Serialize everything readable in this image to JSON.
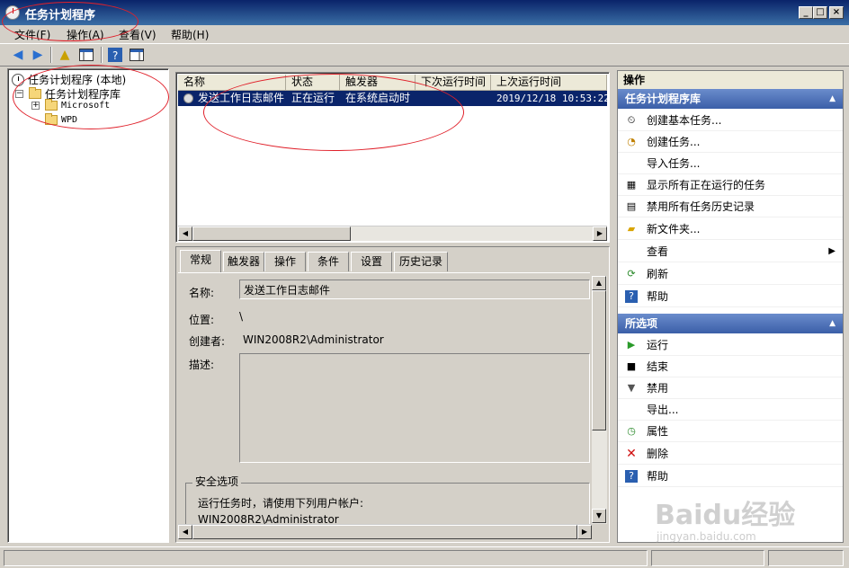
{
  "window": {
    "title": "任务计划程序",
    "controls": {
      "minimize": "_",
      "maximize": "□",
      "close": "×"
    }
  },
  "menu": [
    "文件(F)",
    "操作(A)",
    "查看(V)",
    "帮助(H)"
  ],
  "tree": {
    "root": "任务计划程序 (本地)",
    "library": "任务计划程序库",
    "children": [
      "Microsoft",
      "WPD"
    ],
    "expander_collapsed": "+",
    "expander_expanded": "−"
  },
  "tasklist": {
    "columns": [
      "名称",
      "状态",
      "触发器",
      "下次运行时间",
      "上次运行时间"
    ],
    "rows": [
      {
        "name": "发送工作日志邮件",
        "status": "正在运行",
        "trigger": "在系统启动时",
        "next_run": "",
        "last_run": "2019/12/18 10:53:22"
      }
    ]
  },
  "detail": {
    "tabs": [
      "常规",
      "触发器",
      "操作",
      "条件",
      "设置",
      "历史记录"
    ],
    "active_tab": "常规",
    "fields": {
      "name_label": "名称:",
      "name_value": "发送工作日志邮件",
      "location_label": "位置:",
      "location_value": "\\",
      "author_label": "创建者:",
      "author_value": "WIN2008R2\\Administrator",
      "desc_label": "描述:"
    },
    "security": {
      "title": "安全选项",
      "prompt": "运行任务时，请使用下列用户帐户:",
      "account": "WIN2008R2\\Administrator"
    }
  },
  "actions": {
    "header": "操作",
    "section1_title": "任务计划程序库",
    "section1_items": [
      "创建基本任务...",
      "创建任务...",
      "导入任务...",
      "显示所有正在运行的任务",
      "禁用所有任务历史记录",
      "新文件夹...",
      "查看",
      "刷新",
      "帮助"
    ],
    "section2_title": "所选项",
    "section2_items": [
      "运行",
      "结束",
      "禁用",
      "导出...",
      "属性",
      "删除",
      "帮助"
    ]
  },
  "watermark": {
    "brand": "Baidu经验",
    "url": "jingyan.baidu.com"
  },
  "colors": {
    "selection": "#0a246a",
    "section_header": "#3b5fa8",
    "annotation": "#e0202a"
  }
}
